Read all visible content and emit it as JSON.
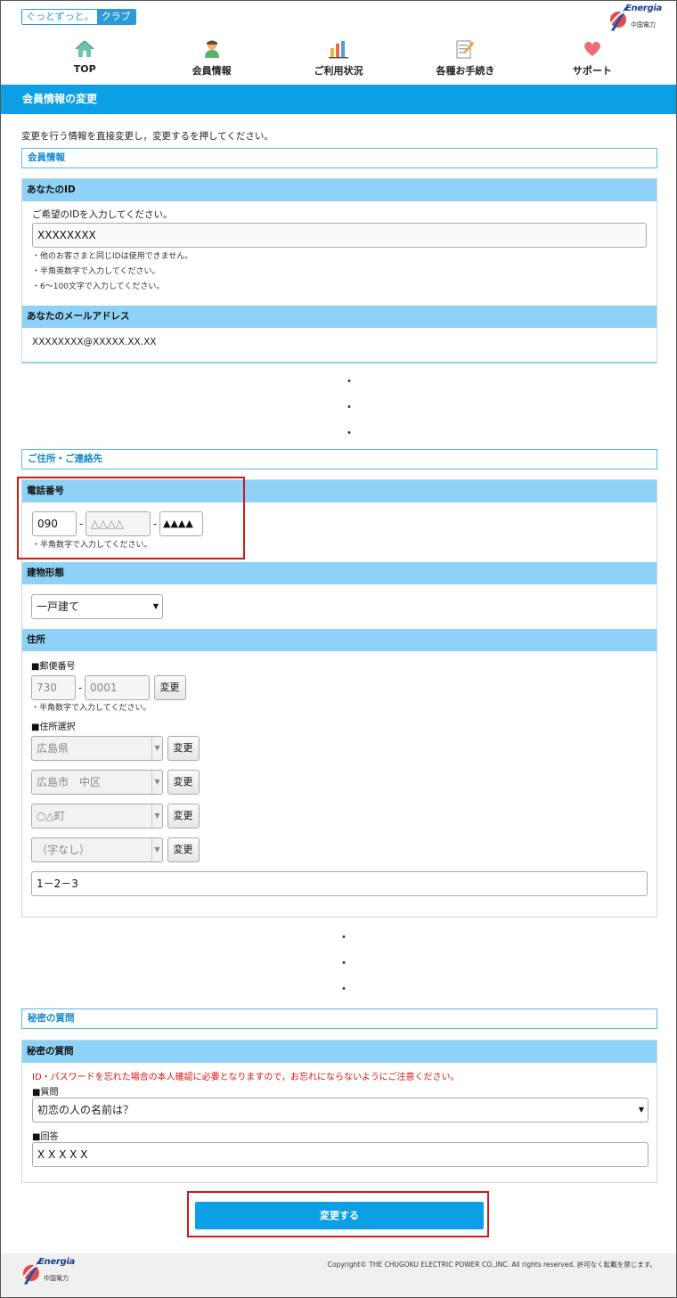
{
  "header": {
    "club_logo_a": "ぐっとずっと。",
    "club_logo_b": "クラブ",
    "brand_en": "Energia",
    "brand_jp": "中国電力"
  },
  "nav": [
    {
      "label": "TOP",
      "icon": "home-icon"
    },
    {
      "label": "会員情報",
      "icon": "member-icon"
    },
    {
      "label": "ご利用状況",
      "icon": "chart-icon"
    },
    {
      "label": "各種お手続き",
      "icon": "form-icon"
    },
    {
      "label": "サポート",
      "icon": "heart-icon"
    }
  ],
  "page_title": "会員情報の変更",
  "intro": "変更を行う情報を直接変更し，変更するを押してください。",
  "member": {
    "section_title": "会員情報",
    "id_head": "あなたのID",
    "id_prompt": "ご希望のIDを入力してください。",
    "id_value": "XXXXXXXX",
    "id_notes": [
      "・他のお客さまと同じIDは使用できません。",
      "・半角英数字で入力してください。",
      "・6～100文字で入力してください。"
    ],
    "email_head": "あなたのメールアドレス",
    "email_value": "XXXXXXXX@XXXXX.XX.XX"
  },
  "ellipsis": "・",
  "contact": {
    "section_title": "ご住所・ご連絡先",
    "phone_head": "電話番号",
    "phone": [
      "090",
      "△△△△",
      "▲▲▲▲"
    ],
    "phone_dash": "-",
    "phone_note": "・半角数字で入力してください。",
    "building_head": "建物形態",
    "building_value": "一戸建て",
    "address_head": "住所",
    "postal_label": "■郵便番号",
    "postal": [
      "730",
      "0001"
    ],
    "change_label": "変更",
    "postal_note": "・半角数字で入力してください。",
    "addr_select_label": "■住所選択",
    "addr_selects": [
      "広島県",
      "広島市　中区",
      "○△町",
      "（字なし）"
    ],
    "addr_detail": "1－2－3"
  },
  "secret": {
    "section_title": "秘密の質問",
    "head": "秘密の質問",
    "warning": "ID・パスワードを忘れた場合の本人確認に必要となりますので，お忘れにならないようにご注意ください。",
    "question_label": "■質問",
    "question_value": "初恋の人の名前は？",
    "answer_label": "■回答",
    "answer_value": "X X X X X"
  },
  "submit_label": "変更する",
  "footer": {
    "copyright": "Copyright© THE CHUGOKU ELECTRIC POWER CO.,INC. All rights reserved. 許可なく転載を禁じます。"
  },
  "colors": {
    "accent": "#0d9fe3",
    "panel_head": "#8ed3f7",
    "highlight": "#d01818"
  }
}
